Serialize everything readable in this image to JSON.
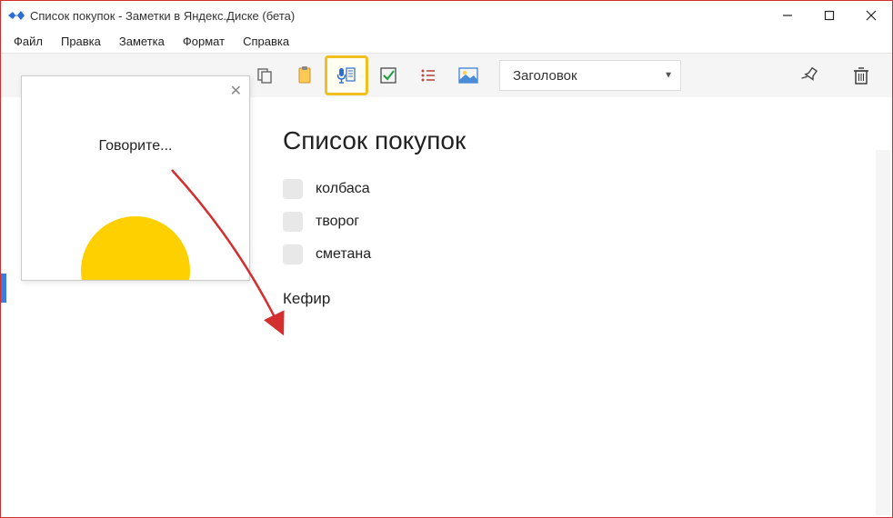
{
  "title": "Список покупок - Заметки в Яндекс.Диске (бета)",
  "menu": {
    "file": "Файл",
    "edit": "Правка",
    "note": "Заметка",
    "format": "Формат",
    "help": "Справка"
  },
  "toolbar": {
    "style_label": "Заголовок"
  },
  "popup": {
    "text": "Говорите..."
  },
  "note": {
    "title": "Список покупок",
    "items": [
      {
        "text": "колбаса"
      },
      {
        "text": "творог"
      },
      {
        "text": "сметана"
      }
    ],
    "plain": "Кефир"
  }
}
